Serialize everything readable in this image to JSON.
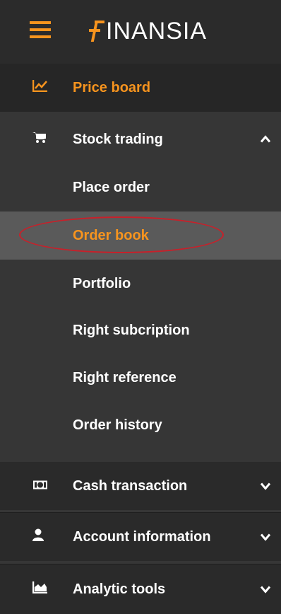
{
  "header": {
    "logo_text": "INANSIA",
    "logo_letter": "F"
  },
  "menu": {
    "price_board": {
      "label": "Price board",
      "icon": "line-chart-icon"
    },
    "stock_trading": {
      "label": "Stock trading",
      "icon": "cart-icon",
      "expanded": true,
      "children": [
        {
          "label": "Place order"
        },
        {
          "label": "Order book",
          "active": true
        },
        {
          "label": "Portfolio"
        },
        {
          "label": "Right subcription"
        },
        {
          "label": "Right reference"
        },
        {
          "label": "Order history"
        }
      ]
    },
    "cash_transaction": {
      "label": "Cash transaction",
      "icon": "money-icon"
    },
    "account_information": {
      "label": "Account information",
      "icon": "user-icon"
    },
    "analytic_tools": {
      "label": "Analytic tools",
      "icon": "area-chart-icon"
    }
  },
  "colors": {
    "accent": "#f7941e",
    "highlight": "#c8202a"
  }
}
